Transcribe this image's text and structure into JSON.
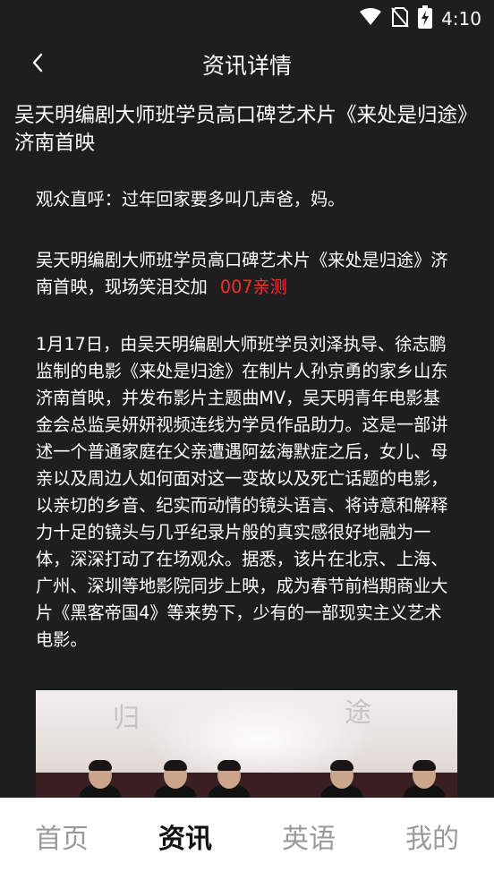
{
  "status_bar": {
    "time": "4:10",
    "icons": [
      "wifi-icon",
      "no-sim-icon",
      "battery-charging-icon"
    ]
  },
  "header": {
    "back_icon": "chevron-left-icon",
    "title": "资讯详情"
  },
  "article": {
    "title": "吴天明编剧大师班学员高口碑艺术片《来处是归途》济南首映",
    "paragraphs": {
      "p1": "观众直呼：过年回家要多叫几声爸，妈。",
      "p2": "吴天明编剧大师班学员高口碑艺术片《来处是归途》济南首映，现场笑泪交加",
      "p2_link": "007亲测",
      "p3": "1月17日，由吴天明编剧大师班学员刘泽执导、徐志鹏监制的电影《来处是归途》在制片人孙京勇的家乡山东济南首映，并发布影片主题曲MV，吴天明青年电影基金会总监吴妍妍视频连线为学员作品助力。这是一部讲述一个普通家庭在父亲遭遇阿兹海默症之后，女儿、母亲以及周边人如何面对这一变故以及死亡话题的电影，以亲切的乡音、纪实而动情的镜头语言、将诗意和解释力十足的镜头与几乎纪录片般的真实感很好地融为一体，深深打动了在场观众。据悉，该片在北京、上海、广州、深圳等地影院同步上映，成为春节前档期商业大片《黑客帝国4》等来势下，少有的一部现实主义艺术电影。"
    }
  },
  "bottom_nav": {
    "items": [
      {
        "label": "首页",
        "active": false
      },
      {
        "label": "资讯",
        "active": true
      },
      {
        "label": "英语",
        "active": false
      },
      {
        "label": "我的",
        "active": false
      }
    ]
  },
  "colors": {
    "background": "#1e1e1e",
    "link_red": "#ff2a2a",
    "nav_active": "#111111",
    "nav_inactive": "#9a9a9a"
  }
}
